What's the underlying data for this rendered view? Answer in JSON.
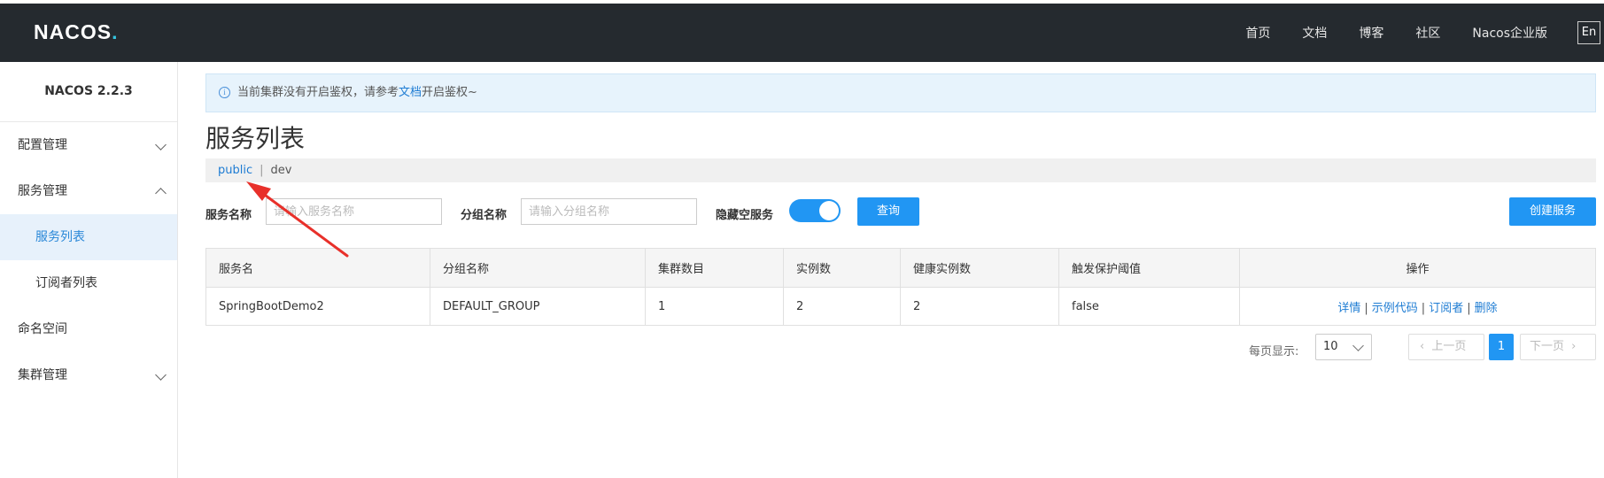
{
  "header": {
    "logo": "NACOS",
    "logo_dot": ".",
    "nav": [
      "首页",
      "文档",
      "博客",
      "社区",
      "Nacos企业版"
    ],
    "lang": "En"
  },
  "sidebar": {
    "version": "NACOS 2.2.3",
    "items": [
      {
        "label": "配置管理"
      },
      {
        "label": "服务管理"
      },
      {
        "label": "服务列表"
      },
      {
        "label": "订阅者列表"
      },
      {
        "label": "命名空间"
      },
      {
        "label": "集群管理"
      }
    ]
  },
  "notice": {
    "text_before": "当前集群没有开启鉴权，请参考",
    "link": "文档",
    "text_after": "开启鉴权~"
  },
  "page_title": "服务列表",
  "namespaces": {
    "items": [
      "public",
      "dev"
    ],
    "separator": "|"
  },
  "filter": {
    "service_name_label": "服务名称",
    "service_name_placeholder": "请输入服务名称",
    "group_name_label": "分组名称",
    "group_name_placeholder": "请输入分组名称",
    "hide_empty_label": "隐藏空服务",
    "hide_empty_on": true,
    "query_button": "查询",
    "create_button": "创建服务"
  },
  "table": {
    "columns": [
      "服务名",
      "分组名称",
      "集群数目",
      "实例数",
      "健康实例数",
      "触发保护阈值",
      "操作"
    ],
    "rows": [
      {
        "service": "SpringBootDemo2",
        "group": "DEFAULT_GROUP",
        "clusters": "1",
        "instances": "2",
        "healthy": "2",
        "threshold": "false"
      }
    ],
    "ops": [
      "详情",
      "示例代码",
      "订阅者",
      "删除"
    ],
    "op_separator": "|"
  },
  "pagination": {
    "per_page_label": "每页显示:",
    "per_page": "10",
    "prev": "上一页",
    "next": "下一页",
    "current": "1"
  },
  "colors": {
    "topbar": "#252a2f",
    "primary": "#2196f3",
    "link": "#1e7cd3",
    "annotation_arrow": "#e8302a"
  }
}
